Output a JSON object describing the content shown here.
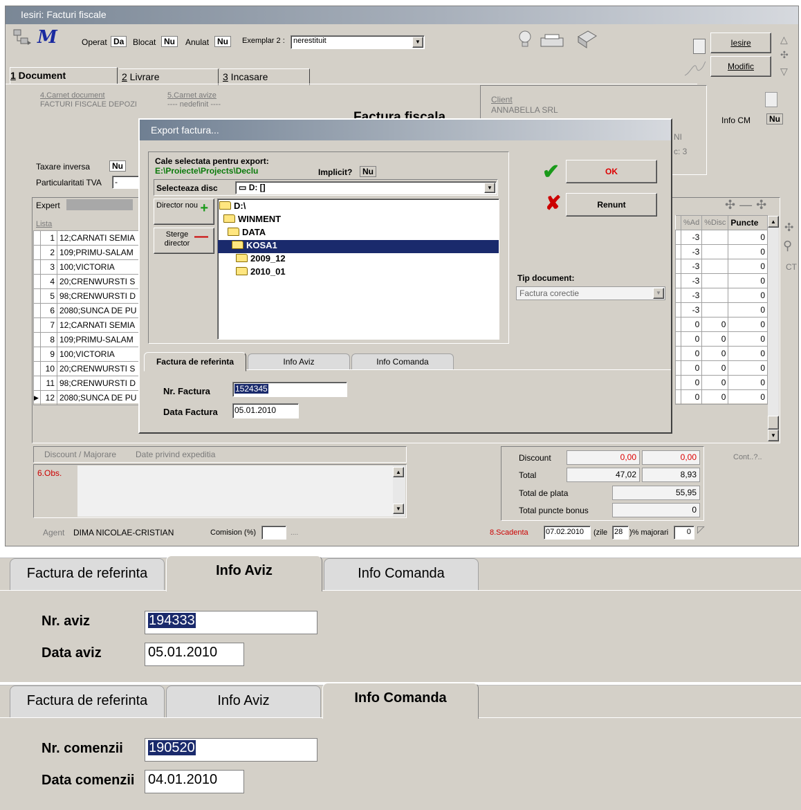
{
  "window": {
    "title": "Iesiri: Facturi fiscale"
  },
  "toolbar": {
    "operat_label": "Operat",
    "operat_val": "Da",
    "blocat_label": "Blocat",
    "blocat_val": "Nu",
    "anulat_label": "Anulat",
    "anulat_val": "Nu",
    "exemplar_label": "Exemplar 2 :",
    "exemplar_val": "nerestituit",
    "iesire": "Iesire",
    "modific": "Modific"
  },
  "tabs": [
    {
      "num": "1",
      "label": " Document"
    },
    {
      "num": "2",
      "label": " Livrare"
    },
    {
      "num": "3",
      "label": " Incasare"
    }
  ],
  "doc": {
    "carnet_doc_label": "4.Carnet document",
    "carnet_doc_val": "FACTURI FISCALE DEPOZI",
    "carnet_avize_label": "5.Carnet avize",
    "carnet_avize_val": "---- nedefinit ----",
    "heading": "Factura fiscala",
    "client_label": "Client",
    "client_val": "ANNABELLA SRL",
    "frag1": "NI",
    "frag2": "c: 3",
    "info_cm_label": "Info CM",
    "info_cm_val": "Nu",
    "taxare_label": "Taxare inversa",
    "taxare_val": "Nu",
    "partic_label": "Particularitati  TVA",
    "partic_val": "-",
    "expert_label": "Expert",
    "lista_label": "Lista"
  },
  "grid": {
    "col_ad": "%Ad",
    "col_disc": "%Disc",
    "col_puncte": "Puncte",
    "rows": [
      {
        "n": "1",
        "name": "12;CARNATI SEMIA",
        "ad": "-3",
        "disc": "",
        "p": "0"
      },
      {
        "n": "2",
        "name": "109;PRIMU-SALAM",
        "ad": "-3",
        "disc": "",
        "p": "0"
      },
      {
        "n": "3",
        "name": "100;VICTORIA",
        "ad": "-3",
        "disc": "",
        "p": "0"
      },
      {
        "n": "4",
        "name": "20;CRENWURSTI S",
        "ad": "-3",
        "disc": "",
        "p": "0"
      },
      {
        "n": "5",
        "name": "98;CRENWURSTI D",
        "ad": "-3",
        "disc": "",
        "p": "0"
      },
      {
        "n": "6",
        "name": "2080;SUNCA DE PU",
        "ad": "-3",
        "disc": "",
        "p": "0"
      },
      {
        "n": "7",
        "name": "12;CARNATI SEMIA",
        "ad": "0",
        "disc": "0",
        "p": "0"
      },
      {
        "n": "8",
        "name": "109;PRIMU-SALAM",
        "ad": "0",
        "disc": "0",
        "p": "0"
      },
      {
        "n": "9",
        "name": "100;VICTORIA",
        "ad": "0",
        "disc": "0",
        "p": "0"
      },
      {
        "n": "10",
        "name": "20;CRENWURSTI S",
        "ad": "0",
        "disc": "0",
        "p": "0"
      },
      {
        "n": "11",
        "name": "98;CRENWURSTI D",
        "ad": "0",
        "disc": "0",
        "p": "0"
      },
      {
        "n": "12",
        "name": "2080;SUNCA DE PU",
        "ad": "0",
        "disc": "0",
        "p": "0"
      }
    ]
  },
  "side": {
    "ct": "CT",
    "cont": "Cont..?.."
  },
  "bottom": {
    "discount_tab": "Discount / Majorare",
    "expeditie_tab": "Date privind expeditia",
    "obs_label": "6.Obs.",
    "agent_label": "Agent",
    "agent_val": "DIMA NICOLAE-CRISTIAN",
    "comision_label": "Comision (%)",
    "comision_dots": "...."
  },
  "totals": {
    "discount_label": "Discount",
    "discount_a": "0,00",
    "discount_b": "0,00",
    "total_label": "Total",
    "total_a": "47,02",
    "total_b": "8,93",
    "total_plata_label": "Total de plata",
    "total_plata": "55,95",
    "puncte_label": "Total puncte bonus",
    "puncte": "0",
    "scadenta_label": "8.Scadenta",
    "scadenta_val": "07.02.2010",
    "zile_label": "(zile",
    "zile_val": "28",
    "majorari_label": ")% majorari",
    "majorari_val": "0"
  },
  "dialog": {
    "title": "Export factura...",
    "cale_label": "Cale selectata pentru export:",
    "cale_val": "E:\\Proiecte\\Projects\\Declu",
    "implicit_label": "Implicit?",
    "implicit_val": "Nu",
    "disc_label": "Selecteaza disc",
    "disc_val": "D: []",
    "director_nou": "Director nou",
    "sterge_director": "Sterge director",
    "tree": [
      "D:\\",
      "WINMENT",
      "DATA",
      "KOSA1",
      "2009_12",
      "2010_01"
    ],
    "ok": "OK",
    "renunt": "Renunt",
    "tip_label": "Tip document:",
    "tip_val": "Factura corectie",
    "tabs": [
      "Factura de referinta",
      "Info Aviz",
      "Info Comanda"
    ],
    "nr_label": "Nr. Factura",
    "nr_val": "1524345",
    "data_label": "Data Factura",
    "data_val": "05.01.2010"
  },
  "aviz_panel": {
    "tabs": [
      "Factura de referinta",
      "Info Aviz",
      "Info Comanda"
    ],
    "nr_label": "Nr. aviz",
    "nr_val": "194333",
    "data_label": "Data aviz",
    "data_val": "05.01.2010"
  },
  "comanda_panel": {
    "tabs": [
      "Factura de referinta",
      "Info Aviz",
      "Info Comanda"
    ],
    "nr_label": "Nr. comenzii",
    "nr_val": "190520",
    "data_label": "Data comenzii",
    "data_val": "04.01.2010"
  }
}
